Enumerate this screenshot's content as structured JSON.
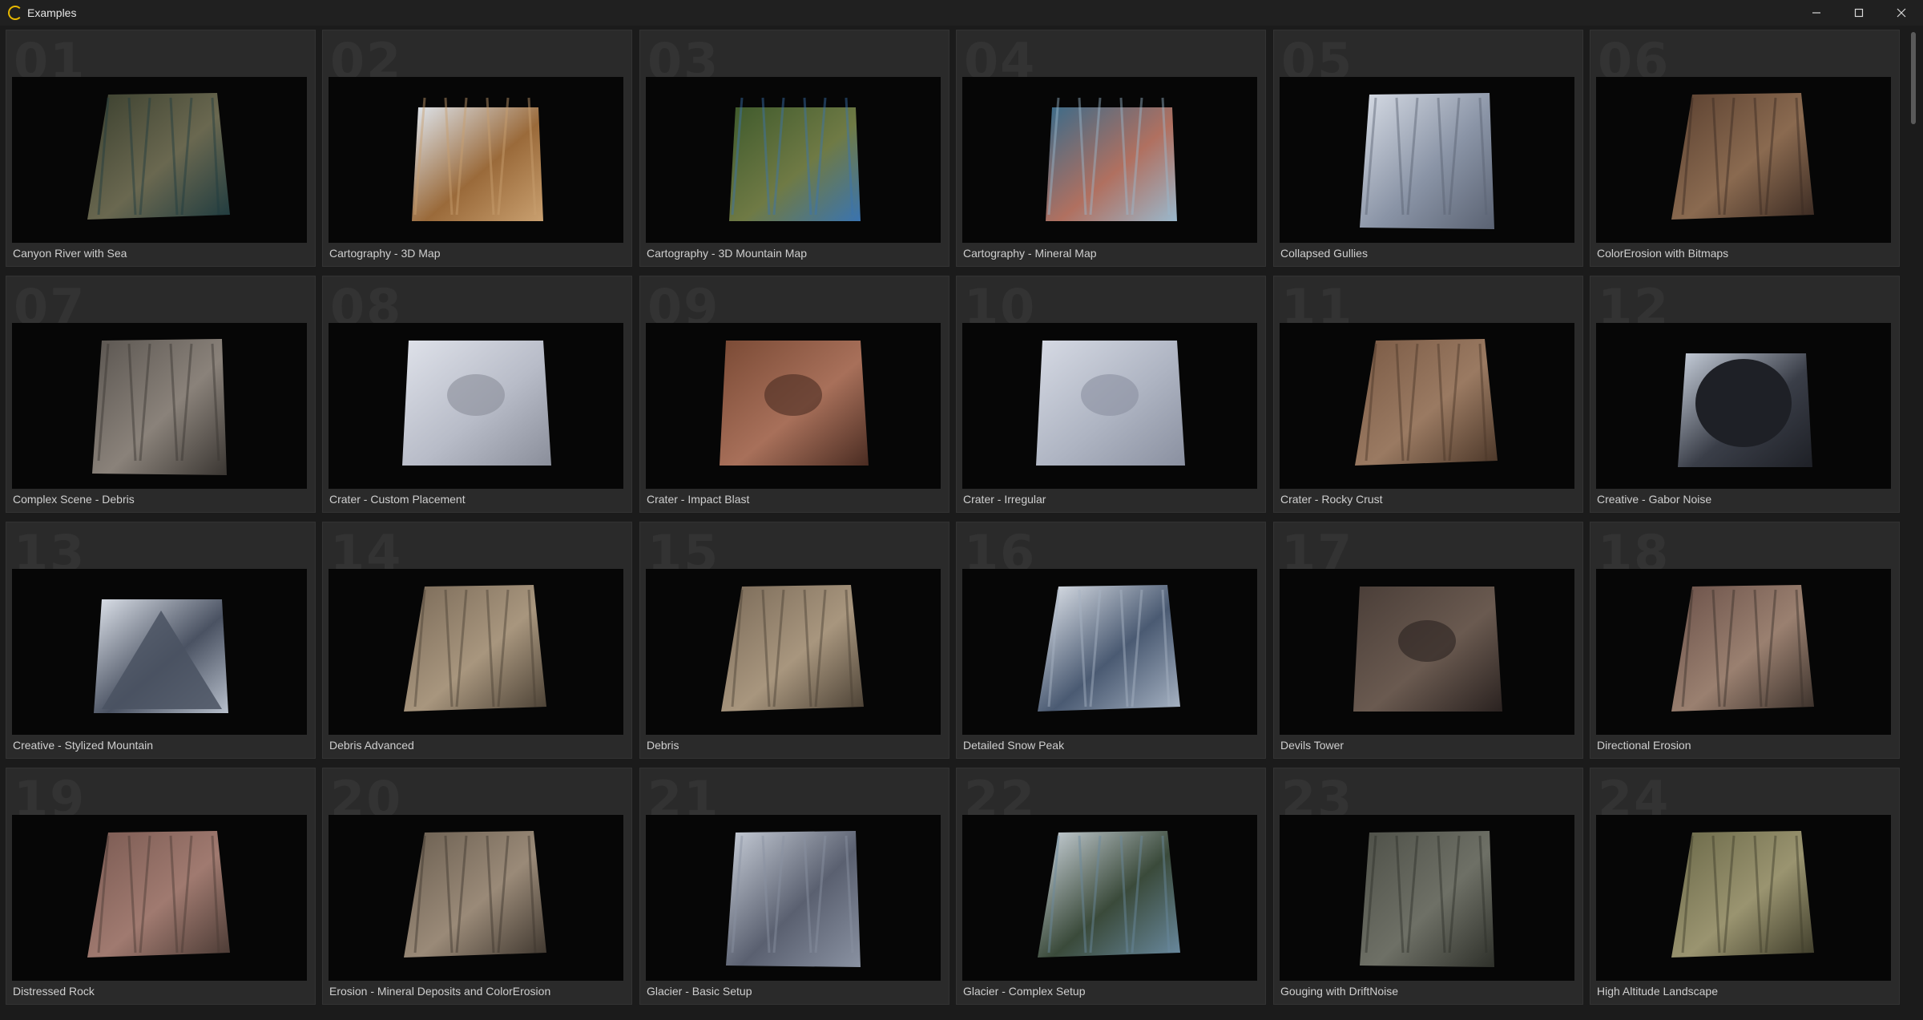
{
  "window": {
    "title": "Examples",
    "controls": {
      "minimize": "minimize-icon",
      "maximize": "maximize-icon",
      "close": "close-icon"
    }
  },
  "examples": [
    {
      "number": "01",
      "name": "Canyon River with Sea",
      "colors": [
        "#3a3f2e",
        "#6a6850",
        "#1f3b3f"
      ],
      "shape": "slab"
    },
    {
      "number": "02",
      "name": "Cartography - 3D Map",
      "colors": [
        "#dfe6ee",
        "#9a6a3a",
        "#c9a070"
      ],
      "shape": "map"
    },
    {
      "number": "03",
      "name": "Cartography - 3D Mountain Map",
      "colors": [
        "#3f5a2c",
        "#6f7a45",
        "#3a74b0"
      ],
      "shape": "map"
    },
    {
      "number": "04",
      "name": "Cartography - Mineral Map",
      "colors": [
        "#3a6b8a",
        "#b07060",
        "#9ab8cc"
      ],
      "shape": "map"
    },
    {
      "number": "05",
      "name": "Collapsed Gullies",
      "colors": [
        "#d8dde6",
        "#8a94a6",
        "#5a6272"
      ],
      "shape": "tall"
    },
    {
      "number": "06",
      "name": "ColorErosion with Bitmaps",
      "colors": [
        "#5a4030",
        "#8a6a50",
        "#3a2a22"
      ],
      "shape": "slab"
    },
    {
      "number": "07",
      "name": "Complex Scene - Debris",
      "colors": [
        "#5a5550",
        "#8a827a",
        "#3a3632"
      ],
      "shape": "tall"
    },
    {
      "number": "08",
      "name": "Crater - Custom Placement",
      "colors": [
        "#dfe2ea",
        "#b8bcc8",
        "#8a8e9a"
      ],
      "shape": "crater"
    },
    {
      "number": "09",
      "name": "Crater - Impact Blast",
      "colors": [
        "#7a4a35",
        "#a8705a",
        "#4a2c22"
      ],
      "shape": "crater"
    },
    {
      "number": "10",
      "name": "Crater - Irregular",
      "colors": [
        "#d6dae4",
        "#aeb4c2",
        "#8a90a0"
      ],
      "shape": "crater"
    },
    {
      "number": "11",
      "name": "Crater - Rocky Crust",
      "colors": [
        "#7a5a45",
        "#9a7a62",
        "#4a3628"
      ],
      "shape": "slab"
    },
    {
      "number": "12",
      "name": "Creative - Gabor Noise",
      "colors": [
        "#c8d0dc",
        "#3a3e48",
        "#1e2026"
      ],
      "shape": "blob"
    },
    {
      "number": "13",
      "name": "Creative - Stylized Mountain",
      "colors": [
        "#dfe4ec",
        "#4a5262",
        "#b8c0cc"
      ],
      "shape": "peak"
    },
    {
      "number": "14",
      "name": "Debris Advanced",
      "colors": [
        "#7a6a58",
        "#a8967e",
        "#4a4034"
      ],
      "shape": "slab"
    },
    {
      "number": "15",
      "name": "Debris",
      "colors": [
        "#7a6a58",
        "#a8967e",
        "#4a4034"
      ],
      "shape": "slab"
    },
    {
      "number": "16",
      "name": "Detailed Snow Peak",
      "colors": [
        "#e6eaf0",
        "#4a5a72",
        "#a8b4c4"
      ],
      "shape": "slab"
    },
    {
      "number": "17",
      "name": "Devils Tower",
      "colors": [
        "#4a3e38",
        "#6a5a50",
        "#2a2220"
      ],
      "shape": "crater"
    },
    {
      "number": "18",
      "name": "Directional Erosion",
      "colors": [
        "#6a5048",
        "#9a8070",
        "#3a302a"
      ],
      "shape": "slab"
    },
    {
      "number": "19",
      "name": "Distressed Rock",
      "colors": [
        "#7a5a52",
        "#a07a70",
        "#4a3a34"
      ],
      "shape": "slab"
    },
    {
      "number": "20",
      "name": "Erosion - Mineral Deposits and ColorErosion",
      "colors": [
        "#6a5e50",
        "#9a8a78",
        "#3e362e"
      ],
      "shape": "slab"
    },
    {
      "number": "21",
      "name": "Glacier - Basic Setup",
      "colors": [
        "#c8ced8",
        "#5a6070",
        "#8a92a2"
      ],
      "shape": "tall"
    },
    {
      "number": "22",
      "name": "Glacier - Complex Setup",
      "colors": [
        "#d0d8e0",
        "#3a4a3a",
        "#6a8aa0"
      ],
      "shape": "slab"
    },
    {
      "number": "23",
      "name": "Gouging with DriftNoise",
      "colors": [
        "#4e5048",
        "#6e7066",
        "#2e302a"
      ],
      "shape": "tall"
    },
    {
      "number": "24",
      "name": "High Altitude Landscape",
      "colors": [
        "#6a6848",
        "#9a9470",
        "#3e3c2a"
      ],
      "shape": "slab"
    }
  ]
}
